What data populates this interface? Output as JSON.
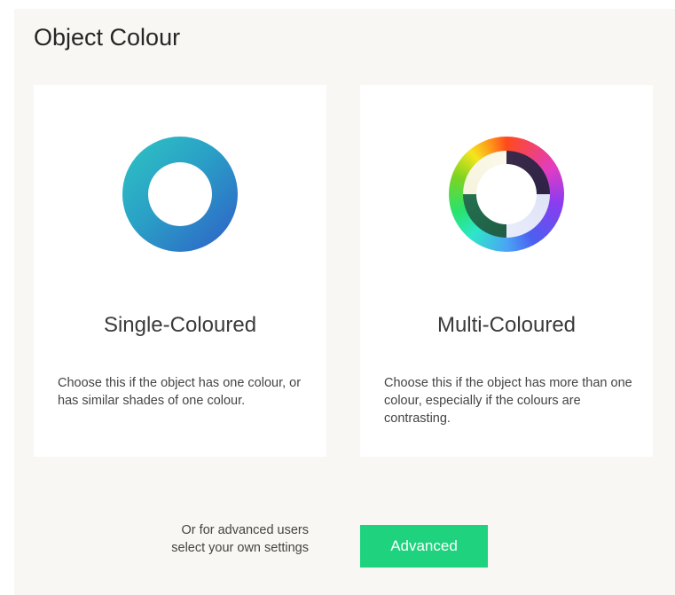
{
  "page_title": "Object Colour",
  "options": [
    {
      "title": "Single-Coloured",
      "description": "Choose this if the object has one colour, or has similar shades of one colour."
    },
    {
      "title": "Multi-Coloured",
      "description": "Choose this if the object has more than one colour, especially if the colours are contrasting."
    }
  ],
  "advanced": {
    "prompt_line1": "Or for advanced users",
    "prompt_line2": "select your own settings",
    "button_label": "Advanced"
  },
  "colors": {
    "background": "#f8f7f3",
    "card": "#ffffff",
    "advanced_button": "#1ed27e",
    "single_ring_start": "#2ec5c4",
    "single_ring_end": "#2f5ec8"
  },
  "icons": {
    "single": "single-colour-ring-icon",
    "multi": "multi-colour-wheel-icon"
  }
}
